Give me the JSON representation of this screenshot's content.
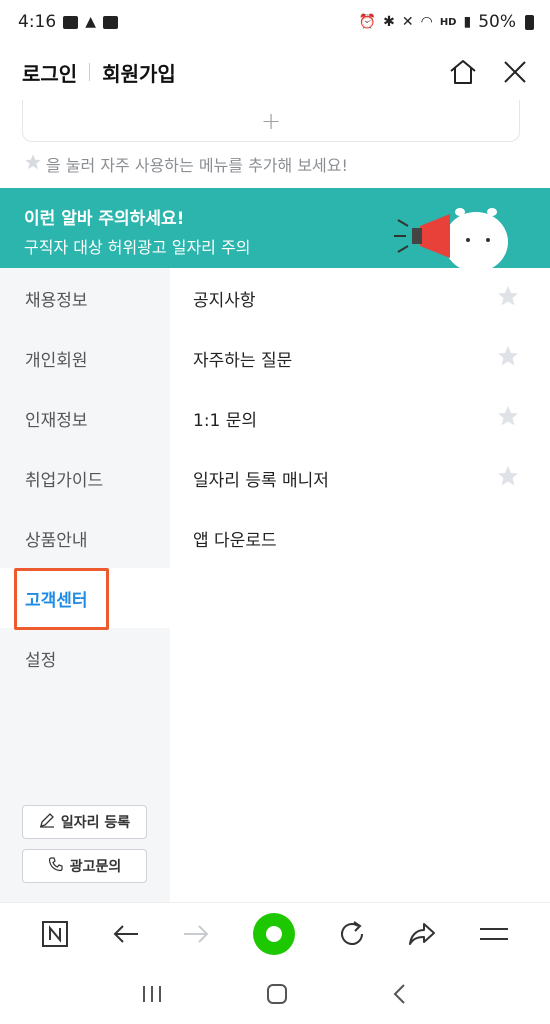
{
  "status": {
    "time": "4:16",
    "hd_label": "HD",
    "battery": "50%"
  },
  "header": {
    "login": "로그인",
    "signup": "회원가입"
  },
  "favorites": {
    "add_symbol": "+",
    "hint": "을 눌러 자주 사용하는 메뉴를 추가해 보세요!"
  },
  "banner": {
    "title": "이런 알바 주의하세요!",
    "subtitle": "구직자 대상 허위광고 일자리 주의"
  },
  "sidebar": {
    "items": [
      {
        "label": "채용정보"
      },
      {
        "label": "개인회원"
      },
      {
        "label": "인재정보"
      },
      {
        "label": "취업가이드"
      },
      {
        "label": "상품안내"
      },
      {
        "label": "고객센터"
      },
      {
        "label": "설정"
      }
    ],
    "active_index": 5,
    "job_post_button": "일자리 등록",
    "ad_inquiry_button": "광고문의"
  },
  "content": {
    "items": [
      {
        "label": "공지사항",
        "starred": false
      },
      {
        "label": "자주하는 질문",
        "starred": false
      },
      {
        "label": "1:1 문의",
        "starred": false
      },
      {
        "label": "일자리 등록 매니저",
        "starred": false
      },
      {
        "label": "앱 다운로드"
      }
    ]
  },
  "colors": {
    "accent": "#1e8ce6",
    "banner": "#2bb5ad",
    "highlight": "#ec5a2e",
    "naver_green": "#1ec800"
  }
}
